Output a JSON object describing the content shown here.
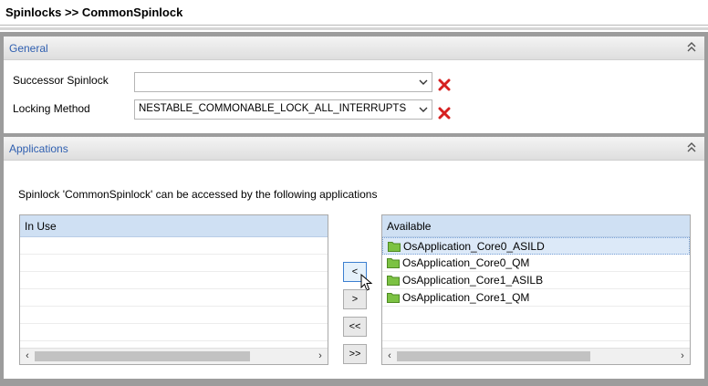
{
  "header": {
    "title": "Spinlocks >> CommonSpinlock"
  },
  "general": {
    "title": "General",
    "successor_label": "Successor Spinlock",
    "successor_value": "",
    "locking_label": "Locking Method",
    "locking_value": "NESTABLE_COMMONABLE_LOCK_ALL_INTERRUPTS"
  },
  "applications": {
    "title": "Applications",
    "description": "Spinlock 'CommonSpinlock' can be accessed by the following applications",
    "in_use": {
      "header": "In Use",
      "items": []
    },
    "available": {
      "header": "Available",
      "items": [
        "OsApplication_Core0_ASILD",
        "OsApplication_Core0_QM",
        "OsApplication_Core1_ASILB",
        "OsApplication_Core1_QM"
      ],
      "selected_index": 0
    },
    "buttons": {
      "add": "<",
      "remove": ">",
      "add_all": "<<",
      "remove_all": ">>"
    }
  },
  "colors": {
    "section_title": "#2f5fb0",
    "list_header": "#cfe0f3",
    "folder": "#7cc243",
    "delete_icon": "#d62020"
  }
}
